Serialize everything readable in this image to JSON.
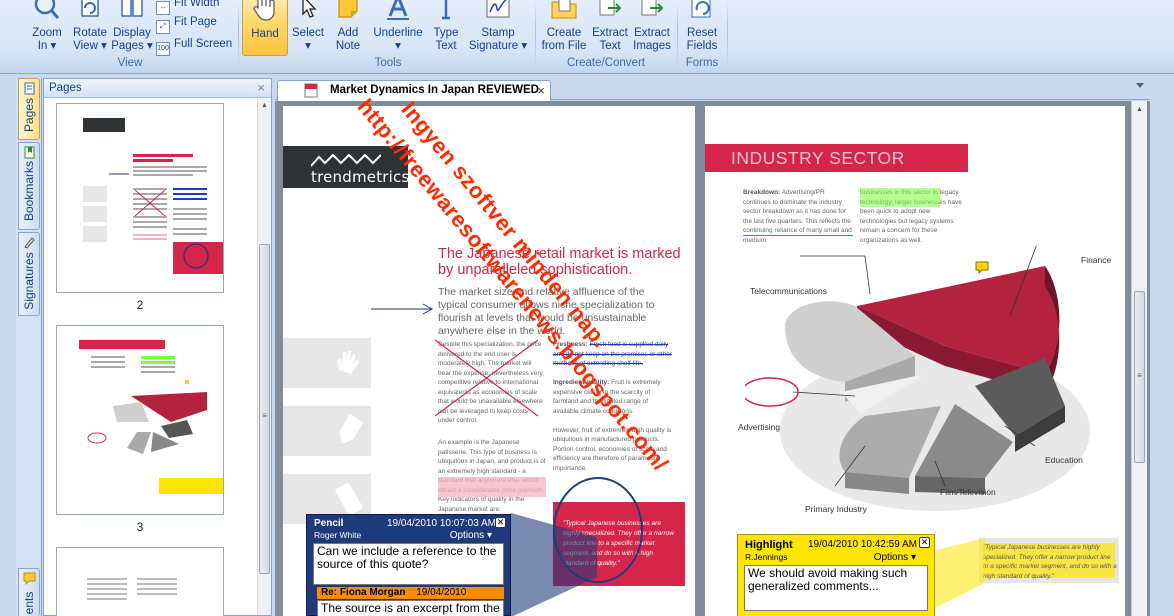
{
  "ribbon": {
    "view": {
      "zoom_in": "Zoom",
      "zoom_in_sub": "In",
      "rotate_view": "Rotate",
      "rotate_view_sub": "View",
      "display_pages": "Display",
      "display_pages_sub": "Pages",
      "fit_width": "Fit Width",
      "fit_page": "Fit Page",
      "full_screen": "Full Screen",
      "group_label": "View"
    },
    "tools": {
      "hand": "Hand",
      "select": "Select",
      "add_note": "Add",
      "add_note_sub": "Note",
      "underline": "Underline",
      "type_text": "Type",
      "type_text_sub": "Text",
      "stamp_signature": "Stamp",
      "stamp_signature_sub": "Signature",
      "group_label": "Tools"
    },
    "create_convert": {
      "create_from_file": "Create",
      "create_from_file_sub": "from File",
      "extract_text": "Extract",
      "extract_text_sub": "Text",
      "extract_images": "Extract",
      "extract_images_sub": "Images",
      "group_label": "Create/Convert"
    },
    "forms": {
      "reset_fields": "Reset",
      "reset_fields_sub": "Fields",
      "group_label": "Forms"
    }
  },
  "side_tabs": {
    "pages": "Pages",
    "bookmarks": "Bookmarks",
    "signatures": "Signatures",
    "comments": "ents"
  },
  "pages_panel": {
    "title": "Pages",
    "close": "×",
    "thumbnails": [
      {
        "page_number": "2"
      },
      {
        "page_number": "3"
      }
    ]
  },
  "document_tab": {
    "title": "Market Dynamics In Japan REVIEWED",
    "close": "×"
  },
  "page2": {
    "logo": "trendmetrics",
    "title": "The Japanese retail market is marked by unparalleled sophistication.",
    "lead": "The market size and relative affluence of the typical consumer allows niche specialization to flourish at levels that would be unsustainable anywhere else in the world.",
    "col1_a": "Despite this specialization, the price delivered to the end user is moderately high. The market will bear the expense, nevertheless very competitive relative to international equivalents as economies of scale that would be unavailable elsewhere can be leveraged to keep costs under control.",
    "col1_b": "An example is the Japanese patisserie. This type of business is ubiquitous in Japan, and product is of an extremely high standard - a standard that anywhere else would attract a considerable price premium. Key indicators of quality in the Japanese market are:",
    "col2_head": "Freshness:",
    "col2_a": "Fresh food is supplied daily and do not keep on the premises or other methods of extending shelf-life.",
    "col2_b_head": "Ingredient quality:",
    "col2_b": "Fruit is extremely expensive owing to the scarcity of farmland and the limited range of available climate conditions.",
    "col2_c": "However, fruit of extremely high quality is ubiquitous in manufactured products. Portion control, economies of scale and efficiency are therefore of paramount importance.",
    "quote": "\"Typical Japanese businesses are highly specialized. They offer a narrow product line to a specific market segment, and do so with a high standard of quality.\""
  },
  "page3": {
    "banner": "INDUSTRY SECTOR",
    "breakdown_head": "Breakdown:",
    "breakdown": "Advertising/PR continues to dominate the industry sector breakdown as it has done for the last five quarters. This reflects the continuing reliance of many small and medium",
    "col2": "businesses in this sector to legacy technology; larger businesses have been quick to adopt new technologies but legacy systems remain a concern for these organizations as well.",
    "labels": {
      "finance": "Finance",
      "telecommunications": "Telecommunications",
      "advertising": "Advertising",
      "education": "Education",
      "film_television": "Film/Television",
      "primary_industry": "Primary Industry"
    },
    "quote": "\"Typical Japanese businesses are highly specialized. They offer a narrow product line to a specific market segment, and do so with a high standard of quality.\""
  },
  "pencil_note": {
    "type": "Pencil",
    "date": "19/04/2010 10:07:03 AM",
    "author": "Roger White",
    "options": "Options",
    "body": "Can we include a reference to the source of this quote?",
    "reply_head": "Re: Fiona Morgan",
    "reply_date": "19/04/2010 10:34:16 AM",
    "reply_body": "The source is an excerpt from the interview below."
  },
  "highlight_note": {
    "type": "Highlight",
    "date": "19/04/2010 10:42:59 AM",
    "author": "R.Jennings",
    "options": "Options",
    "body": "We should avoid making such generalized comments..."
  },
  "watermark": {
    "line1": "Ingyen szoftver minden nap.",
    "line2": "http://freewaresoftwarenews.blogspot.com/"
  },
  "colors": {
    "accent_red": "#d6254a",
    "note_blue": "#1f3a7a",
    "note_yellow": "#ffe600",
    "watermark": "#ff2a00"
  }
}
